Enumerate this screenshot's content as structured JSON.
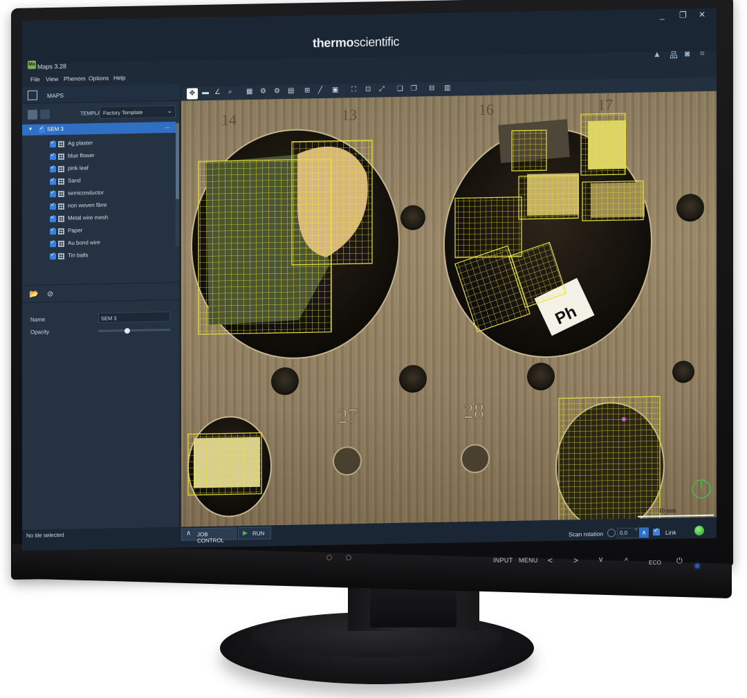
{
  "window": {
    "app_title": "Maps 3.28",
    "app_icon_text": "Ma",
    "brand_bold": "thermo",
    "brand_light": "scientific",
    "controls": [
      "_",
      "❐",
      "✕"
    ]
  },
  "menu": [
    "File",
    "View",
    "Phenom",
    "Options",
    "Help"
  ],
  "left_panel": {
    "section_title": "MAPS",
    "template_label": "TEMPLATE",
    "template_value": "Factory Template",
    "tree_root": "SEM 3",
    "tree_root_more": "...",
    "layers": [
      "Ag plaster",
      "blue flower",
      "pink leaf",
      "Sand",
      "semiconductor",
      "non woven fibre",
      "Metal wire mesh",
      "Paper",
      "Au bond wire",
      "Tin balls"
    ],
    "properties": {
      "name_label": "Name",
      "name_value": "SEM 3",
      "opacity_label": "Opacity",
      "opacity_value": 0.4
    }
  },
  "canvas": {
    "scale_label": "10 mm",
    "sample_numbers": [
      "14",
      "13",
      "16",
      "17",
      "27",
      "28"
    ],
    "paper_label": "Ph"
  },
  "status": {
    "text": "No tile selected",
    "job_control": "JOB CONTROL",
    "run": "RUN",
    "scan_rotation_label": "Scan rotation",
    "scan_rotation_value": "0.0",
    "degree_symbol": "°",
    "link_label": "Link"
  },
  "monitor_buttons": [
    "INPUT",
    "MENU",
    "<",
    ">",
    "v",
    "^",
    "ECO",
    "⏻"
  ],
  "colors": {
    "selection": "#2f6fc4",
    "overlay_grid": "#e8e23a",
    "status_ok": "#3fc24a"
  }
}
